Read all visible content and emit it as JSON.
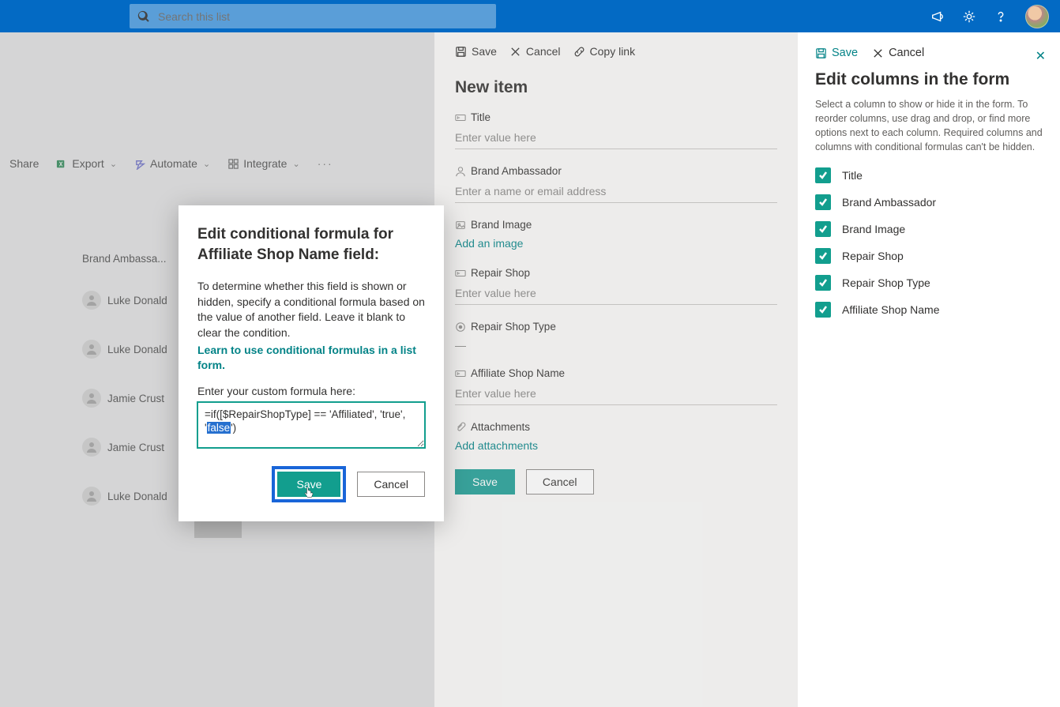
{
  "search": {
    "placeholder": "Search this list"
  },
  "cmdbar": {
    "share": "Share",
    "export": "Export",
    "automate": "Automate",
    "integrate": "Integrate"
  },
  "list": {
    "column_header": "Brand Ambassa...",
    "rows": [
      "Luke Donald",
      "Luke Donald",
      "Jamie Crust",
      "Jamie Crust",
      "Luke Donald"
    ]
  },
  "new_item": {
    "actions": {
      "save": "Save",
      "cancel": "Cancel",
      "copylink": "Copy link"
    },
    "title": "New item",
    "fields": {
      "title_label": "Title",
      "title_placeholder": "Enter value here",
      "brand_amb_label": "Brand Ambassador",
      "brand_amb_placeholder": "Enter a name or email address",
      "brand_image_label": "Brand Image",
      "brand_image_link": "Add an image",
      "repair_shop_label": "Repair Shop",
      "repair_shop_placeholder": "Enter value here",
      "repair_shop_type_label": "Repair Shop Type",
      "repair_shop_type_value": "—",
      "affiliate_label": "Affiliate Shop Name",
      "affiliate_placeholder": "Enter value here",
      "attachments_label": "Attachments",
      "attachments_link": "Add attachments"
    },
    "buttons": {
      "save": "Save",
      "cancel": "Cancel"
    }
  },
  "edit_columns": {
    "actions": {
      "save": "Save",
      "cancel": "Cancel"
    },
    "title": "Edit columns in the form",
    "description": "Select a column to show or hide it in the form. To reorder columns, use drag and drop, or find more options next to each column. Required columns and columns with conditional formulas can't be hidden.",
    "items": [
      "Title",
      "Brand Ambassador",
      "Brand Image",
      "Repair Shop",
      "Repair Shop Type",
      "Affiliate Shop Name"
    ]
  },
  "modal": {
    "title": "Edit conditional formula for Affiliate Shop Name field:",
    "body": "To determine whether this field is shown or hidden, specify a conditional formula based on the value of another field. Leave it blank to clear the condition.",
    "link": "Learn to use conditional formulas in a list form.",
    "input_label": "Enter your custom formula here:",
    "formula_pre": "=if([$RepairShopType] == 'Affiliated', 'true', '",
    "formula_sel": "false",
    "formula_post": "')",
    "save": "Save",
    "cancel": "Cancel"
  }
}
